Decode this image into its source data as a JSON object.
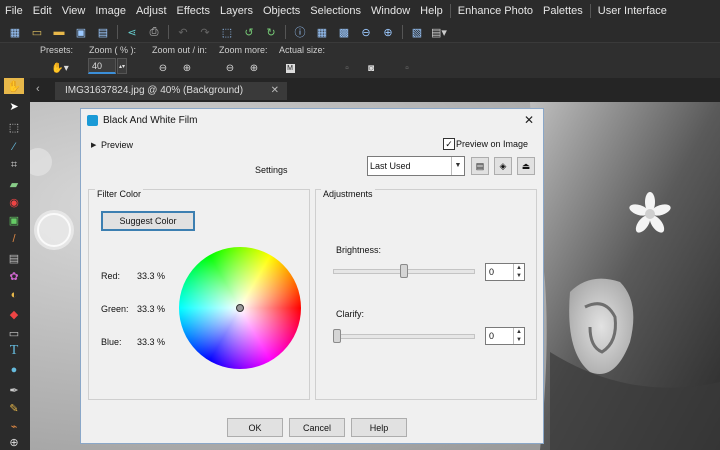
{
  "menu": [
    "File",
    "Edit",
    "View",
    "Image",
    "Adjust",
    "Effects",
    "Layers",
    "Objects",
    "Selections",
    "Window",
    "Help",
    "Enhance Photo",
    "Palettes",
    "User Interface"
  ],
  "options": {
    "presets_label": "Presets:",
    "zoom_label": "Zoom ( % ):",
    "zoom_value": "40",
    "zoom_out_in_label": "Zoom out / in:",
    "zoom_more_label": "Zoom more:",
    "actual_size_label": "Actual size:"
  },
  "tab": {
    "title": "IMG31637824.jpg @  40% (Background)",
    "close": "✕"
  },
  "dialog": {
    "title": "Black And White Film",
    "close": "✕",
    "preview_label": "Preview",
    "preview_on_image_label": "Preview on Image",
    "preview_on_image_checked": true,
    "settings_label": "Settings",
    "settings_value": "Last Used",
    "filter_color_label": "Filter Color",
    "suggest_color_label": "Suggest Color",
    "red_label": "Red:",
    "red_value": "33.3 %",
    "green_label": "Green:",
    "green_value": "33.3 %",
    "blue_label": "Blue:",
    "blue_value": "33.3 %",
    "adjustments_label": "Adjustments",
    "brightness_label": "Brightness:",
    "brightness_value": "0",
    "brightness_level": 0.5,
    "clarify_label": "Clarify:",
    "clarify_value": "0",
    "clarify_level": 0.0,
    "ok_label": "OK",
    "cancel_label": "Cancel",
    "help_label": "Help"
  },
  "colors": {
    "accent": "#3b8fd9",
    "titlebar_icon": "#1a9ad6"
  }
}
